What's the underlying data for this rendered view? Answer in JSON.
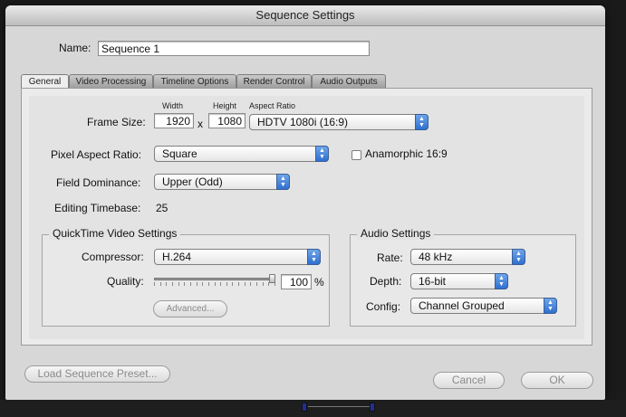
{
  "window": {
    "title": "Sequence Settings"
  },
  "name": {
    "label": "Name:",
    "value": "Sequence 1"
  },
  "tabs": [
    {
      "label": "General",
      "active": true
    },
    {
      "label": "Video Processing",
      "active": false
    },
    {
      "label": "Timeline Options",
      "active": false
    },
    {
      "label": "Render Control",
      "active": false
    },
    {
      "label": "Audio Outputs",
      "active": false
    }
  ],
  "general": {
    "width_header": "Width",
    "height_header": "Height",
    "aspect_ratio_header": "Aspect Ratio",
    "frame_size_label": "Frame Size:",
    "width_value": "1920",
    "times_symbol": "x",
    "height_value": "1080",
    "aspect_ratio_value": "HDTV 1080i (16:9)",
    "pixel_aspect_label": "Pixel Aspect Ratio:",
    "pixel_aspect_value": "Square",
    "anamorphic_label": "Anamorphic 16:9",
    "anamorphic_checked": false,
    "field_dominance_label": "Field Dominance:",
    "field_dominance_value": "Upper (Odd)",
    "editing_timebase_label": "Editing Timebase:",
    "editing_timebase_value": "25"
  },
  "quicktime": {
    "title": "QuickTime Video Settings",
    "compressor_label": "Compressor:",
    "compressor_value": "H.264",
    "quality_label": "Quality:",
    "quality_value": "100",
    "quality_percent": 1.0,
    "quality_unit": "%",
    "advanced_button": "Advanced..."
  },
  "audio": {
    "title": "Audio Settings",
    "rate_label": "Rate:",
    "rate_value": "48 kHz",
    "depth_label": "Depth:",
    "depth_value": "16-bit",
    "config_label": "Config:",
    "config_value": "Channel Grouped"
  },
  "footer": {
    "load_preset_button": "Load Sequence Preset...",
    "cancel_button": "Cancel",
    "ok_button": "OK"
  },
  "colors": {
    "popup_accent": "#2f6fd0",
    "window_bg": "#d7d7d7"
  }
}
